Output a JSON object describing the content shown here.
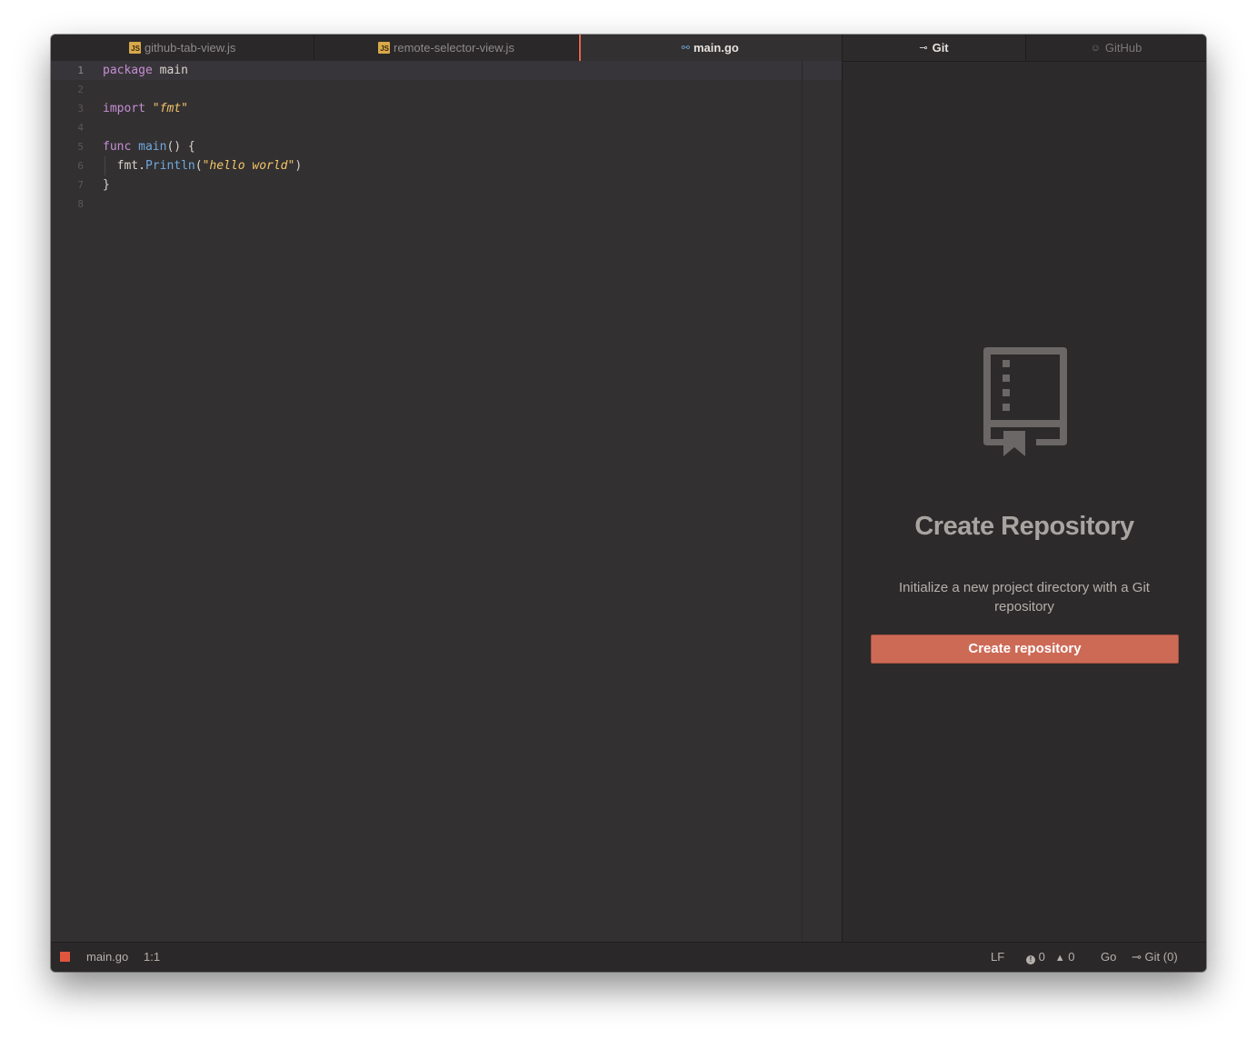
{
  "editor_tabs": [
    {
      "icon": "js-file-icon",
      "icon_text": "JS",
      "label": "github-tab-view.js",
      "active": false
    },
    {
      "icon": "js-file-icon",
      "icon_text": "JS",
      "label": "remote-selector-view.js",
      "active": false
    },
    {
      "icon": "go-file-icon",
      "icon_text": "⚯",
      "label": "main.go",
      "active": true
    }
  ],
  "code": {
    "line_numbers": [
      "1",
      "2",
      "3",
      "4",
      "5",
      "6",
      "7",
      "8"
    ],
    "lines": [
      [
        {
          "t": "package",
          "c": "kw"
        },
        {
          "t": " main",
          "c": "plain"
        }
      ],
      [],
      [
        {
          "t": "import",
          "c": "kw"
        },
        {
          "t": " ",
          "c": "plain"
        },
        {
          "t": "\"fmt\"",
          "c": "str"
        }
      ],
      [],
      [
        {
          "t": "func",
          "c": "kw"
        },
        {
          "t": " ",
          "c": "plain"
        },
        {
          "t": "main",
          "c": "fn"
        },
        {
          "t": "() {",
          "c": "plain"
        }
      ],
      [
        {
          "t": "  fmt.",
          "c": "plain"
        },
        {
          "t": "Println",
          "c": "fn"
        },
        {
          "t": "(",
          "c": "plain"
        },
        {
          "t": "\"hello world\"",
          "c": "str"
        },
        {
          "t": ")",
          "c": "plain"
        }
      ],
      [
        {
          "t": "}",
          "c": "plain"
        }
      ],
      []
    ],
    "current_line": 1
  },
  "panel_tabs": {
    "git": {
      "icon": "⊸",
      "label": "Git"
    },
    "github": {
      "icon": "☺",
      "label": "GitHub"
    }
  },
  "git_panel": {
    "title": "Create Repository",
    "description": "Initialize a new project directory with a Git repository",
    "button_label": "Create repository"
  },
  "status_bar": {
    "file_name": "main.go",
    "cursor_position": "1:1",
    "line_ending": "LF",
    "errors": "0",
    "warnings": "0",
    "grammar": "Go",
    "git_label": "Git (0)"
  },
  "colors": {
    "accent": "#cd6a56",
    "active_tab_marker": "#e0674c",
    "editor_bg": "#333032",
    "panel_bg": "#2c2a2a"
  }
}
